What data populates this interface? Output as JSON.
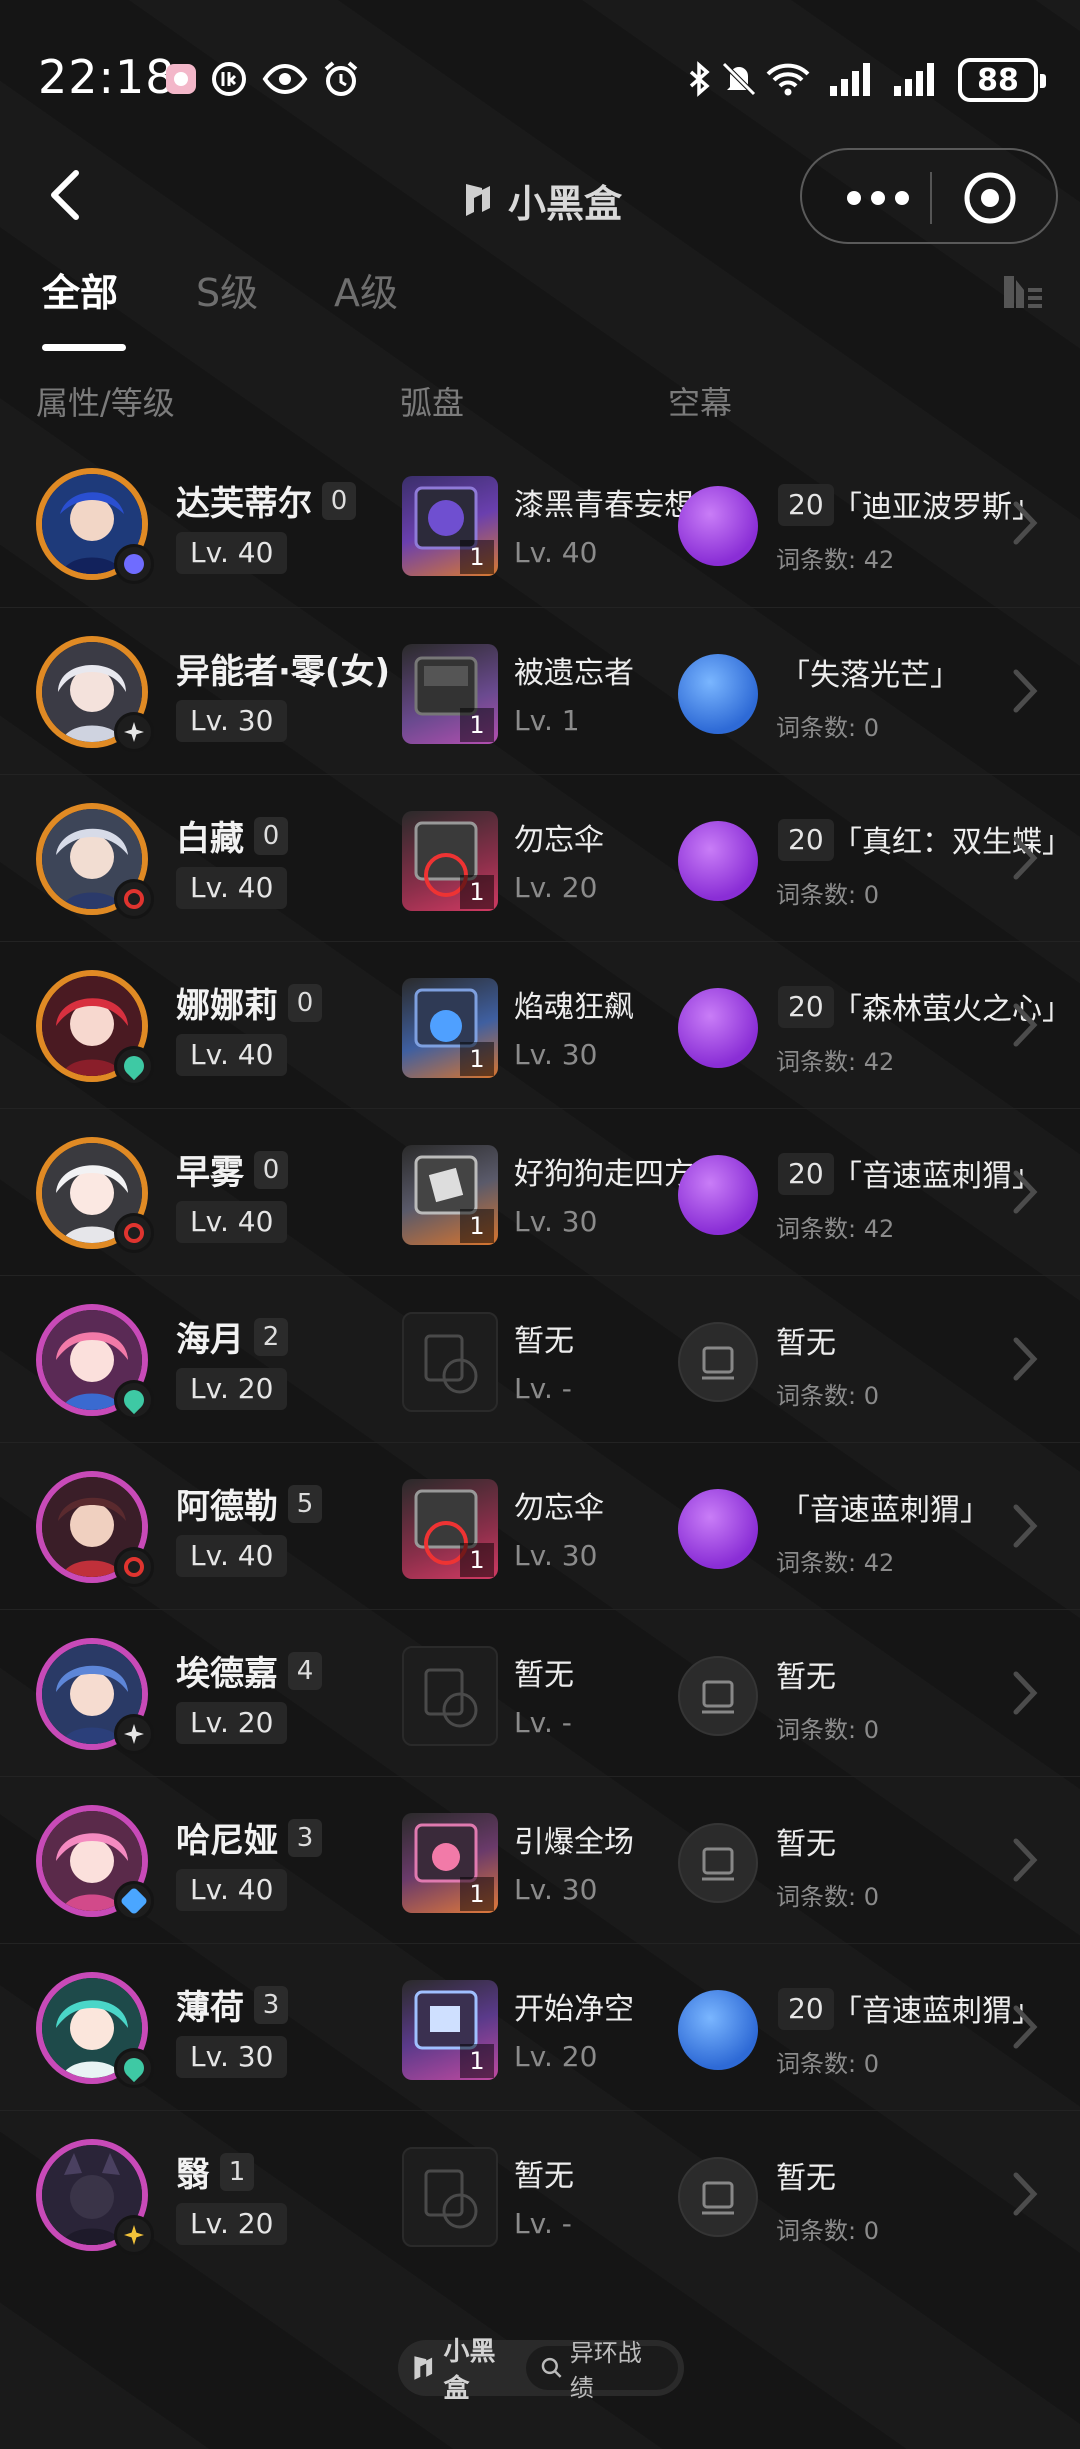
{
  "status": {
    "time": "22:18",
    "battery": "88"
  },
  "header": {
    "title": "小黑盒"
  },
  "tabs": [
    {
      "label": "全部"
    },
    {
      "label": "S级"
    },
    {
      "label": "A级"
    }
  ],
  "columns": {
    "attr_level": "属性/等级",
    "disk": "弧盘",
    "sky": "空幕"
  },
  "rows": [
    {
      "name": "达芙蒂尔",
      "rank": "0",
      "level": "Lv. 40",
      "disk_name": "漆黑青春妄想",
      "disk_lv": "Lv. 40",
      "disk_num": "1",
      "sky_num": "20",
      "sky_name": "「迪亚波罗斯」",
      "sky_count": "词条数: 42"
    },
    {
      "name": "异能者·零(女)",
      "rank": "",
      "level": "Lv. 30",
      "disk_name": "被遗忘者",
      "disk_lv": "Lv. 1",
      "disk_num": "1",
      "sky_num": "",
      "sky_name": "「失落光芒」",
      "sky_count": "词条数: 0"
    },
    {
      "name": "白藏",
      "rank": "0",
      "level": "Lv. 40",
      "disk_name": "勿忘伞",
      "disk_lv": "Lv. 20",
      "disk_num": "1",
      "sky_num": "20",
      "sky_name": "「真红：双生蝶」",
      "sky_count": "词条数: 0"
    },
    {
      "name": "娜娜莉",
      "rank": "0",
      "level": "Lv. 40",
      "disk_name": "焰魂狂飙",
      "disk_lv": "Lv. 30",
      "disk_num": "1",
      "sky_num": "20",
      "sky_name": "「森林萤火之心」",
      "sky_count": "词条数: 42"
    },
    {
      "name": "早雾",
      "rank": "0",
      "level": "Lv. 40",
      "disk_name": "好狗狗走四方",
      "disk_lv": "Lv. 30",
      "disk_num": "1",
      "sky_num": "20",
      "sky_name": "「音速蓝刺猬」",
      "sky_count": "词条数: 42"
    },
    {
      "name": "海月",
      "rank": "2",
      "level": "Lv. 20",
      "disk_name": "暂无",
      "disk_lv": "Lv. -",
      "disk_num": "",
      "sky_num": "",
      "sky_name": "暂无",
      "sky_count": "词条数: 0"
    },
    {
      "name": "阿德勒",
      "rank": "5",
      "level": "Lv. 40",
      "disk_name": "勿忘伞",
      "disk_lv": "Lv. 30",
      "disk_num": "1",
      "sky_num": "",
      "sky_name": "「音速蓝刺猬」",
      "sky_count": "词条数: 42"
    },
    {
      "name": "埃德嘉",
      "rank": "4",
      "level": "Lv. 20",
      "disk_name": "暂无",
      "disk_lv": "Lv. -",
      "disk_num": "",
      "sky_num": "",
      "sky_name": "暂无",
      "sky_count": "词条数: 0"
    },
    {
      "name": "哈尼娅",
      "rank": "3",
      "level": "Lv. 40",
      "disk_name": "引爆全场",
      "disk_lv": "Lv. 30",
      "disk_num": "1",
      "sky_num": "",
      "sky_name": "暂无",
      "sky_count": "词条数: 0"
    },
    {
      "name": "薄荷",
      "rank": "3",
      "level": "Lv. 30",
      "disk_name": "开始净空",
      "disk_lv": "Lv. 20",
      "disk_num": "1",
      "sky_num": "20",
      "sky_name": "「音速蓝刺猬」",
      "sky_count": "词条数: 0"
    },
    {
      "name": "翳",
      "rank": "1",
      "level": "Lv. 20",
      "disk_name": "暂无",
      "disk_lv": "Lv. -",
      "disk_num": "",
      "sky_num": "",
      "sky_name": "暂无",
      "sky_count": "词条数: 0"
    }
  ],
  "footer": {
    "brand": "小黑盒",
    "search_label": "异环战绩"
  },
  "colors": {
    "gold_ring": "#e08a24",
    "purple_ring": "#c84ab8",
    "purple_sky": "#8a2ed6",
    "blue_sky": "#2e6ad6"
  }
}
